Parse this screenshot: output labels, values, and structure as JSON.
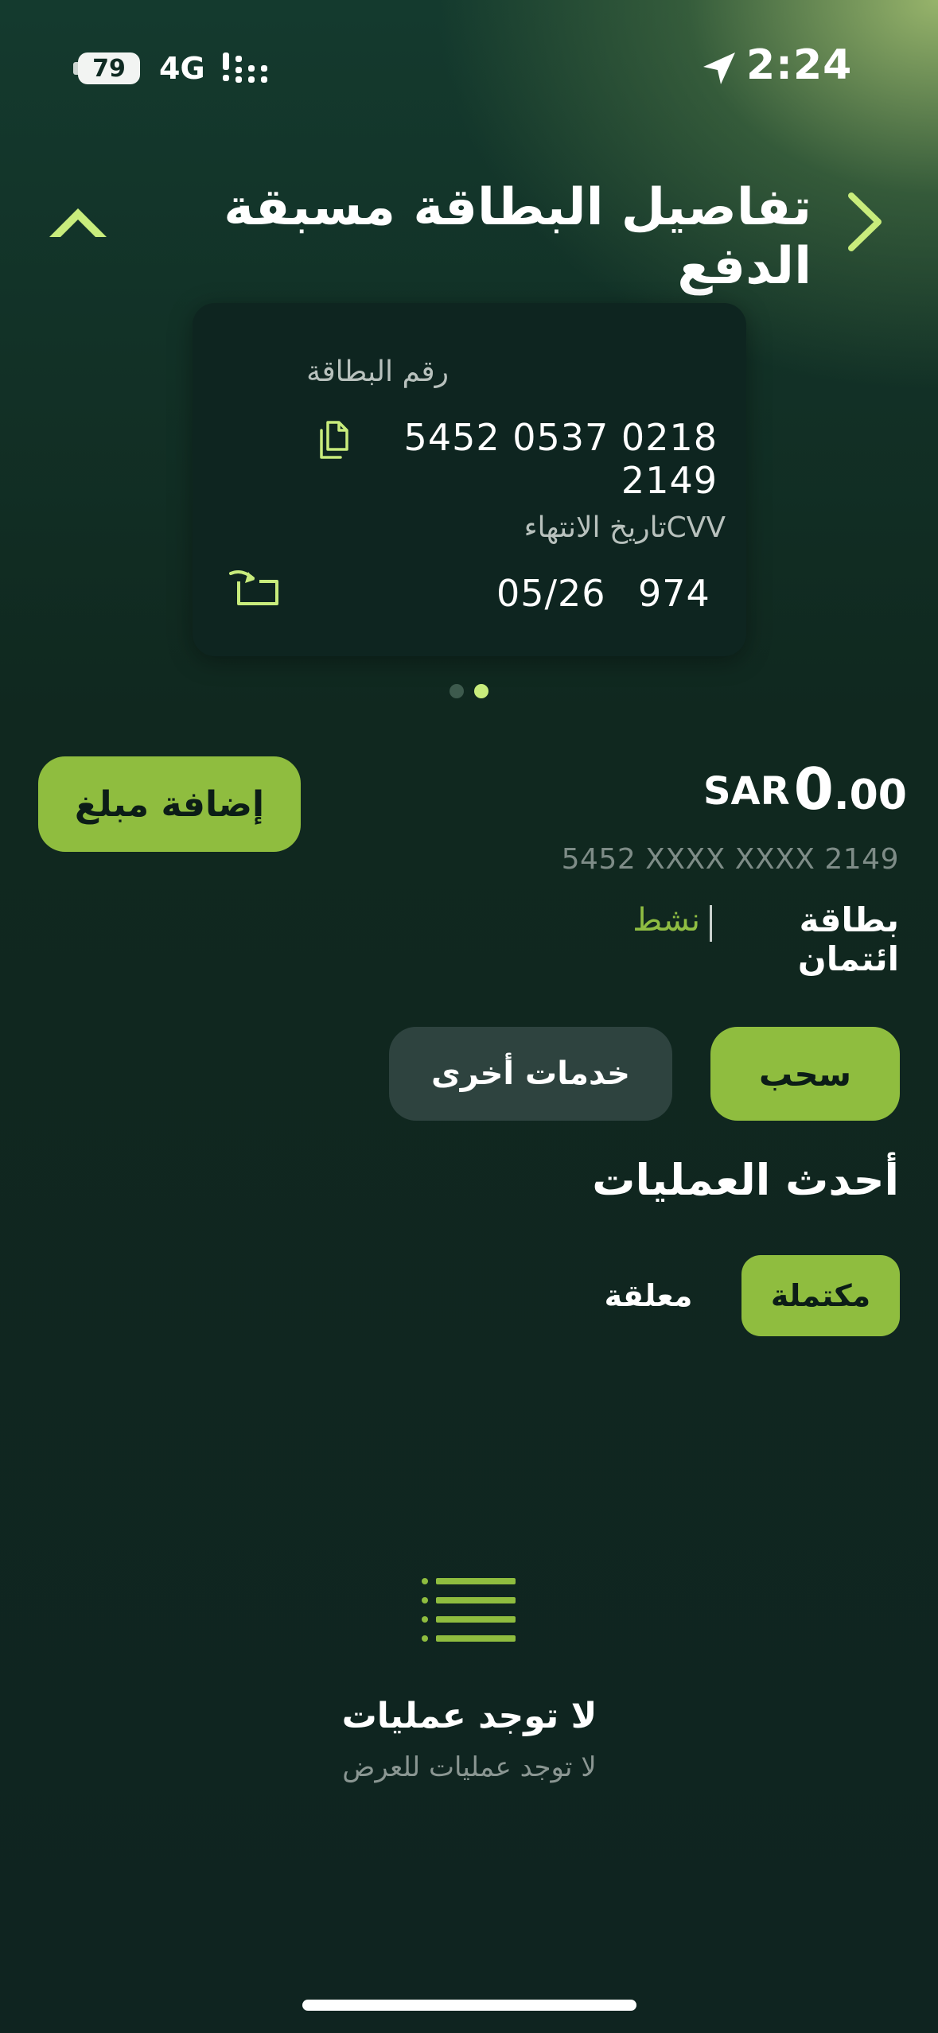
{
  "status_bar": {
    "time": "2:24",
    "battery": "79",
    "network": "4G",
    "icons": [
      "location-arrow-icon",
      "signal-icon"
    ]
  },
  "header": {
    "title": "تفاصيل البطاقة مسبقة الدفع",
    "back_icon": "chevron-right-icon",
    "collapse_icon": "chevron-up-icon"
  },
  "card": {
    "number_label": "رقم البطاقة",
    "number": "5452 0537 0218 2149",
    "cvv_label": "CVV",
    "cvv": "974",
    "expiry_label": "تاريخ الانتهاء",
    "expiry": "05/26",
    "copy_icon": "copy-icon",
    "flip_icon": "flip-card-icon"
  },
  "pager": {
    "count": 2,
    "active_index": 1
  },
  "balance": {
    "currency": "SAR",
    "integer": "0",
    "decimal": ".00"
  },
  "masked_number": "5452 XXXX XXXX 2149",
  "card_type": "بطاقة ائتمان",
  "card_status": "نشط",
  "buttons": {
    "add_amount": "إضافة مبلغ",
    "withdraw": "سحب",
    "other_services": "خدمات أخرى"
  },
  "transactions": {
    "title": "أحدث العمليات",
    "tab_completed": "مكتملة",
    "tab_pending": "معلقة",
    "empty_title": "لا توجد عمليات",
    "empty_subtitle": "لا توجد عمليات للعرض",
    "empty_icon": "list-icon"
  },
  "colors": {
    "accent": "#8fbd3f",
    "accent_light": "#c8ec7c",
    "background": "#0f2420",
    "card_bg": "#0e2520",
    "secondary_button": "#2e433f",
    "status_active": "#8fbd42"
  }
}
